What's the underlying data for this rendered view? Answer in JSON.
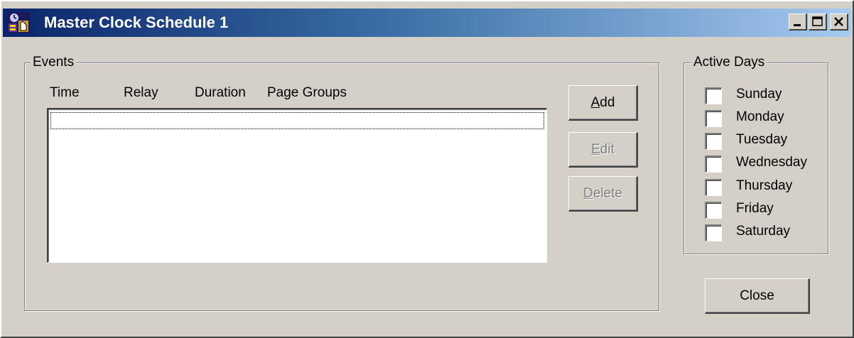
{
  "window": {
    "title": "Master Clock Schedule 1",
    "icon": "clock-app-icon",
    "controls": [
      "minimize-icon",
      "maximize-icon",
      "close-icon"
    ]
  },
  "events": {
    "group_label": "Events",
    "columns": [
      "Time",
      "Relay",
      "Duration",
      "Page Groups"
    ],
    "rows": [],
    "buttons": {
      "add": {
        "mnemonic": "A",
        "rest": "dd",
        "enabled": true
      },
      "edit": {
        "mnemonic": "E",
        "rest": "dit",
        "enabled": false
      },
      "delete": {
        "mnemonic": "D",
        "rest": "elete",
        "enabled": false
      }
    }
  },
  "active_days": {
    "group_label": "Active Days",
    "days": [
      {
        "label": "Sunday",
        "checked": false
      },
      {
        "label": "Monday",
        "checked": false
      },
      {
        "label": "Tuesday",
        "checked": false
      },
      {
        "label": "Wednesday",
        "checked": false
      },
      {
        "label": "Thursday",
        "checked": false
      },
      {
        "label": "Friday",
        "checked": false
      },
      {
        "label": "Saturday",
        "checked": false
      }
    ]
  },
  "close_button": {
    "label": "Close"
  }
}
